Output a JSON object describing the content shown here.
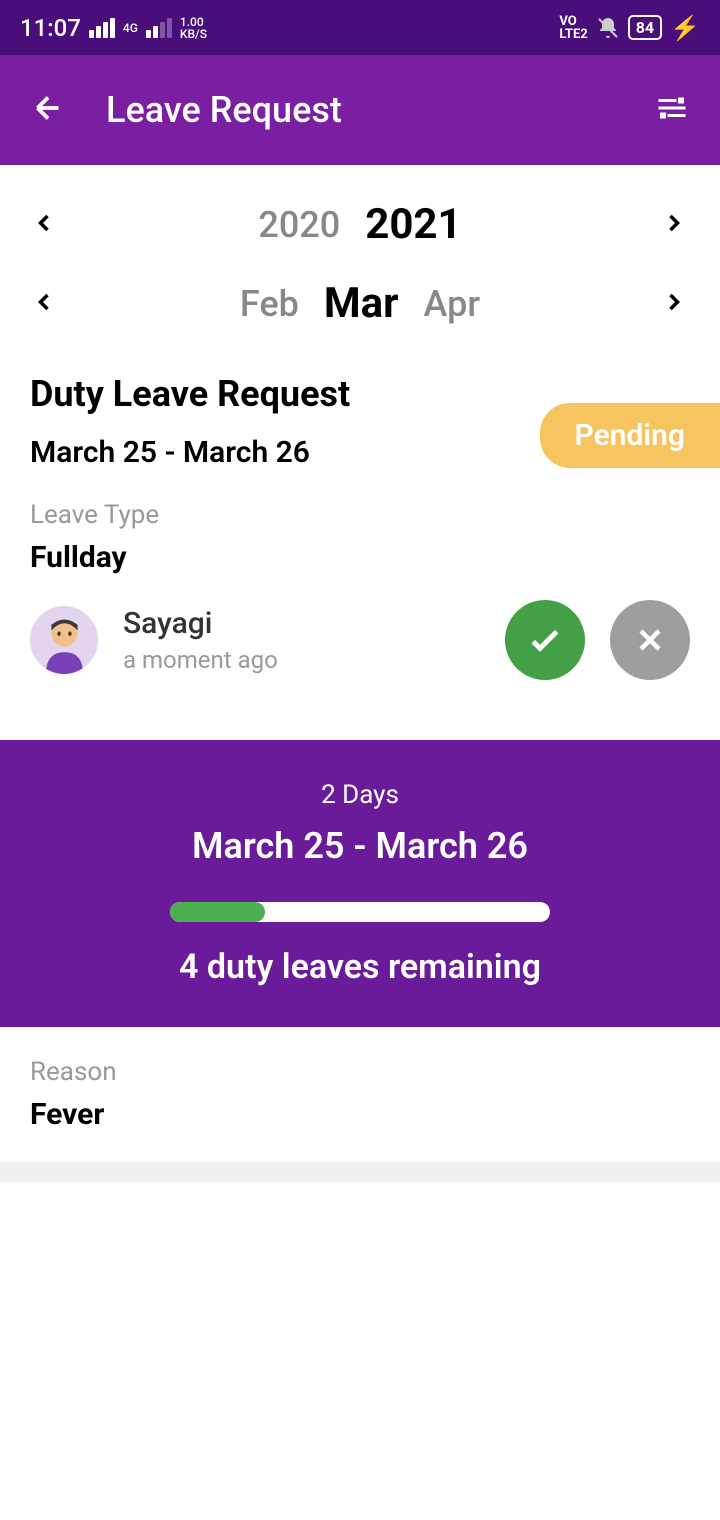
{
  "status_bar": {
    "time": "11:07",
    "network_type": "4G",
    "speed": "1.00",
    "speed_unit": "KB/S",
    "volte": "VO LTE2",
    "battery": "84"
  },
  "app_bar": {
    "title": "Leave Request"
  },
  "year_picker": {
    "prev": "2020",
    "current": "2021"
  },
  "month_picker": {
    "prev": "Feb",
    "current": "Mar",
    "next": "Apr"
  },
  "request": {
    "title": "Duty Leave Request",
    "date_range": "March 25 - March 26",
    "status": "Pending",
    "leave_type_label": "Leave Type",
    "leave_type_value": "Fullday",
    "user_name": "Sayagi",
    "user_time": "a moment ago"
  },
  "summary": {
    "days": "2 Days",
    "range": "March 25 - March 26",
    "remaining": "4 duty leaves remaining",
    "progress_percent": 25
  },
  "reason": {
    "label": "Reason",
    "value": "Fever"
  }
}
